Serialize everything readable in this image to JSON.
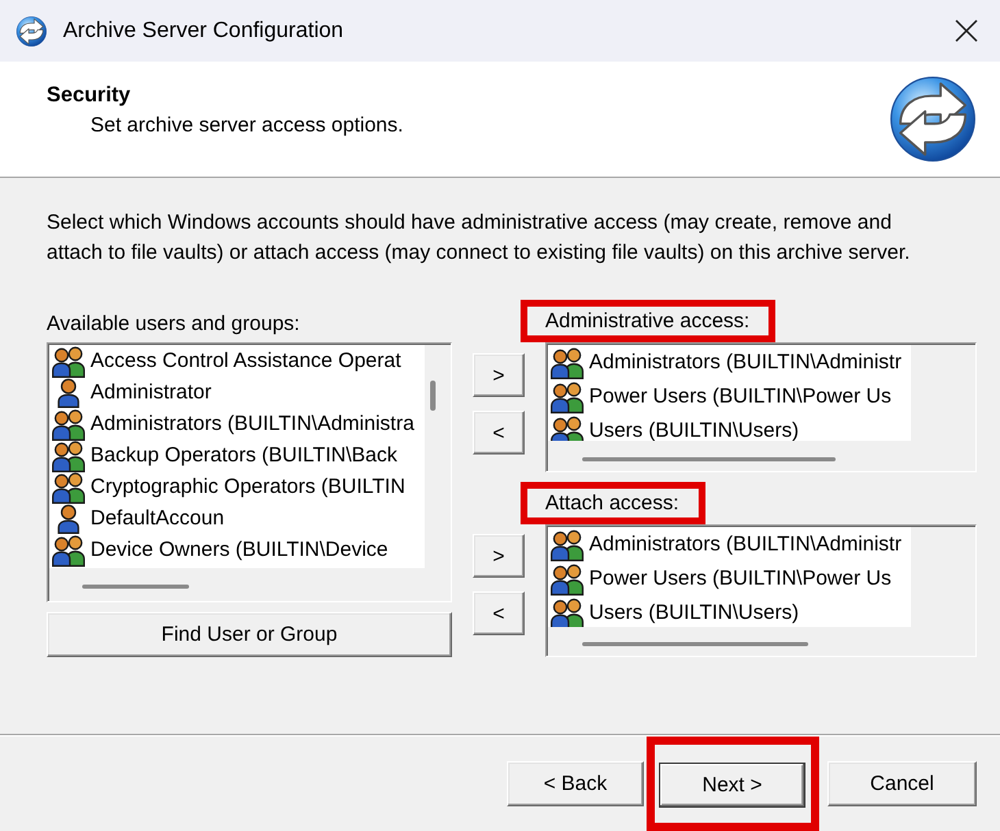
{
  "window": {
    "title": "Archive Server Configuration"
  },
  "header": {
    "title": "Security",
    "subtitle": "Set archive server access options."
  },
  "description": "Select which Windows accounts should have administrative access (may create, remove and attach to file vaults) or attach access (may connect to existing file vaults) on this archive server.",
  "available": {
    "label": "Available users and groups:",
    "items": [
      {
        "kind": "group",
        "name": "Access Control Assistance Operat",
        "selected": false
      },
      {
        "kind": "user",
        "name": "Administrator",
        "selected": false
      },
      {
        "kind": "group",
        "name": "Administrators (BUILTIN\\Administra",
        "selected": false
      },
      {
        "kind": "group",
        "name": "Backup Operators (BUILTIN\\Back",
        "selected": false
      },
      {
        "kind": "group",
        "name": "Cryptographic Operators (BUILTIN",
        "selected": false
      },
      {
        "kind": "user",
        "name": "DefaultAccoun",
        "selected": false
      },
      {
        "kind": "group",
        "name": "Device Owners (BUILTIN\\Device",
        "selected": false
      }
    ],
    "find_button": "Find User or Group"
  },
  "access_lists": [
    {
      "label": "Administrative access:",
      "highlighted": true,
      "add_button": ">",
      "remove_button": "<",
      "items": [
        {
          "kind": "group",
          "name": "Administrators (BUILTIN\\Administr",
          "selected": false
        },
        {
          "kind": "group",
          "name": "Power Users (BUILTIN\\Power Us",
          "selected": false
        },
        {
          "kind": "group",
          "name": "Users (BUILTIN\\Users)",
          "selected": false
        }
      ]
    },
    {
      "label": "Attach access:",
      "highlighted": true,
      "add_button": ">",
      "remove_button": "<",
      "items": [
        {
          "kind": "group",
          "name": "Administrators (BUILTIN\\Administr",
          "selected": false
        },
        {
          "kind": "group",
          "name": "Power Users (BUILTIN\\Power Us",
          "selected": false
        },
        {
          "kind": "group",
          "name": "Users (BUILTIN\\Users)",
          "selected": false
        }
      ]
    }
  ],
  "buttons": [
    {
      "label": "< Back",
      "default": false,
      "highlighted": false
    },
    {
      "label": "Next >",
      "default": true,
      "highlighted": true
    },
    {
      "label": "Cancel",
      "default": false,
      "highlighted": false
    }
  ]
}
